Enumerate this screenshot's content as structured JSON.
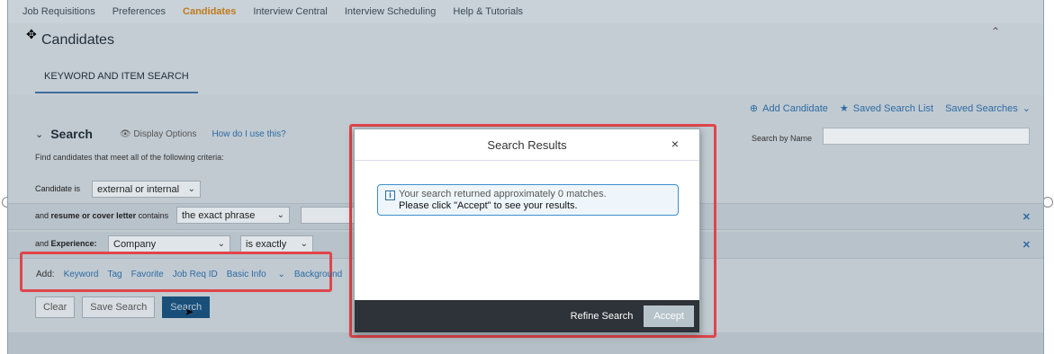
{
  "nav": {
    "items": [
      {
        "label": "Job Requisitions",
        "active": false
      },
      {
        "label": "Preferences",
        "active": false
      },
      {
        "label": "Candidates",
        "active": true
      },
      {
        "label": "Interview Central",
        "active": false
      },
      {
        "label": "Interview Scheduling",
        "active": false
      },
      {
        "label": "Help & Tutorials",
        "active": false
      }
    ]
  },
  "page": {
    "title": "Candidates",
    "tab": "KEYWORD AND ITEM SEARCH"
  },
  "actions": {
    "add_candidate": "Add Candidate",
    "saved_search_list": "Saved Search List",
    "saved_searches": "Saved Searches"
  },
  "search": {
    "title": "Search",
    "display_options": "Display Options",
    "how_to": "How do I use this?",
    "criteria_text": "Find candidates that meet all of the following criteria:",
    "by_name_label": "Search by Name",
    "rows": {
      "candidate_label": "Candidate is",
      "candidate_value": "external or internal",
      "resume_prefix": "and ",
      "resume_bold": "resume or cover letter",
      "resume_suffix": " contains",
      "resume_value": "the exact phrase",
      "exp_prefix": "and ",
      "exp_bold": "Experience:",
      "exp_field": "Company",
      "exp_operator": "is exactly"
    },
    "add_label": "Add:",
    "add_links": [
      "Keyword",
      "Tag",
      "Favorite",
      "Job Req ID",
      "Basic Info",
      "Background"
    ],
    "buttons": {
      "clear": "Clear",
      "save": "Save Search",
      "search": "Search"
    }
  },
  "dialog": {
    "title": "Search Results",
    "close": "×",
    "message_line1": "Your search returned approximately 0 matches.",
    "message_line2": "Please click \"Accept\" to see your results.",
    "refine": "Refine Search",
    "accept": "Accept"
  },
  "colors": {
    "accent": "#c07a1a",
    "link": "#2c6aa3",
    "highlight": "#e0454a",
    "dialog_footer": "#2d3338"
  }
}
